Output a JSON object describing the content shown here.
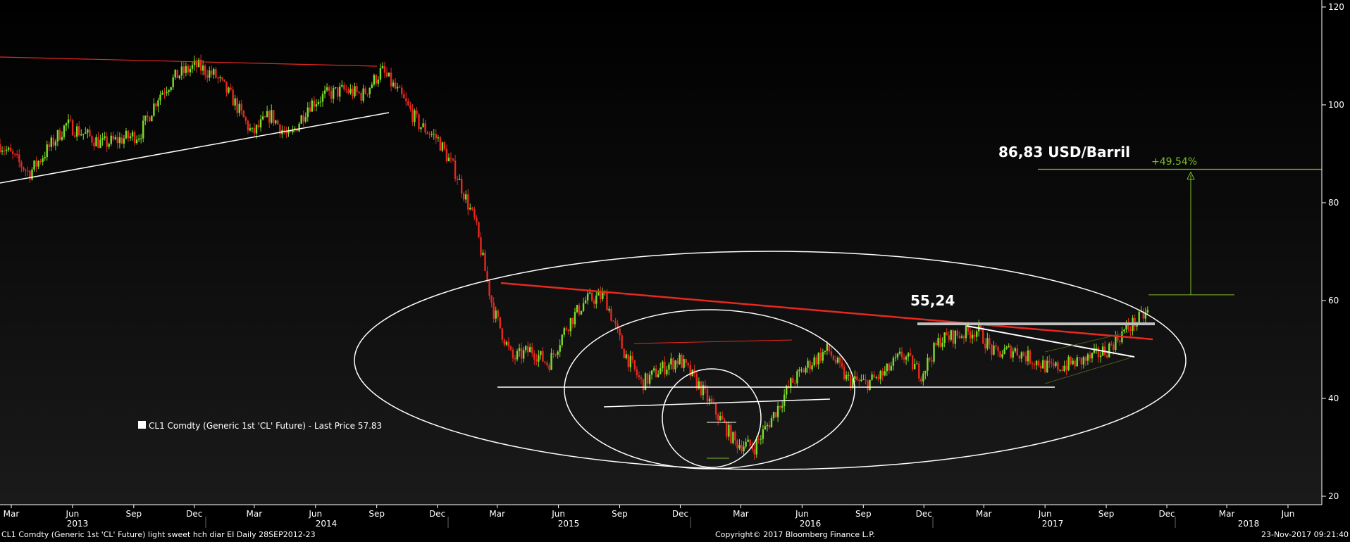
{
  "chart_data": {
    "type": "line",
    "subtype": "candlestick",
    "y_axis": {
      "side": "right",
      "ylim": [
        20,
        121
      ],
      "ticks": [
        20,
        40,
        60,
        80,
        100,
        120
      ]
    },
    "x_axis": {
      "month_ticks": [
        "Mar",
        "Jun",
        "Sep",
        "Dec",
        "Mar",
        "Jun",
        "Sep",
        "Dec",
        "Mar",
        "Jun",
        "Sep",
        "Dec",
        "Mar",
        "Jun",
        "Sep",
        "Dec",
        "Mar",
        "Jun",
        "Sep",
        "Dec",
        "Mar",
        "Jun"
      ],
      "year_labels": [
        "2013",
        "2014",
        "2015",
        "2016",
        "2017",
        "2018"
      ]
    },
    "series": [
      {
        "name": "CL1 Comdty (Generic 1st 'CL' Future) - Last Price 57.83",
        "x": [
          "2012-09-28",
          "2012-11",
          "2013-01",
          "2013-03",
          "2013-05",
          "2013-06",
          "2013-07",
          "2013-08",
          "2013-09",
          "2013-10",
          "2013-11",
          "2013-12",
          "2014-01",
          "2014-02",
          "2014-03",
          "2014-04",
          "2014-05",
          "2014-06",
          "2014-07",
          "2014-08",
          "2014-09",
          "2014-10",
          "2014-11",
          "2014-12",
          "2015-01",
          "2015-02",
          "2015-03",
          "2015-04",
          "2015-05",
          "2015-06",
          "2015-07",
          "2015-08",
          "2015-09",
          "2015-10",
          "2015-11",
          "2015-12",
          "2016-01",
          "2016-02",
          "2016-03",
          "2016-04",
          "2016-05",
          "2016-06",
          "2016-07",
          "2016-08",
          "2016-09",
          "2016-10",
          "2016-11",
          "2016-12",
          "2017-01",
          "2017-02",
          "2017-03",
          "2017-04",
          "2017-05",
          "2017-06",
          "2017-07",
          "2017-08",
          "2017-09",
          "2017-10",
          "2017-11-23"
        ],
        "values": [
          92,
          86,
          96,
          92,
          94,
          102,
          106,
          108,
          106,
          101,
          94,
          98,
          93,
          100,
          102,
          103,
          102,
          107,
          102,
          96,
          93,
          86,
          76,
          58,
          48,
          50,
          47,
          55,
          60,
          61,
          50,
          43,
          46,
          48,
          43,
          37,
          31,
          30,
          36,
          43,
          47,
          50,
          44,
          43,
          45,
          49,
          45,
          52,
          53,
          54,
          49,
          50,
          48,
          46,
          47,
          48,
          50,
          54,
          57.83
        ],
        "up_color": "#7ddc2a",
        "down_color": "#e8281f"
      }
    ],
    "annotations": {
      "price_label": "55,24",
      "target_label": "86,83 USD/Barril",
      "percent_label": "+49.54%",
      "legend_text": "CL1 Comdty (Generic 1st 'CL' Future) - Last Price 57.83",
      "resistance_level": 55.24,
      "target_level": 86.83,
      "breakout_level": 58,
      "ellipse_color": "#ffffff",
      "trendline_red": "#e8281f",
      "target_color": "#7dbd2a"
    }
  },
  "footer": {
    "left": "CL1 Comdty (Generic 1st 'CL' Future) light sweet hch diar EI  Daily 28SEP2012-23",
    "center": "Copyright© 2017 Bloomberg Finance L.P.",
    "right": "23-Nov-2017 09:21:40"
  }
}
